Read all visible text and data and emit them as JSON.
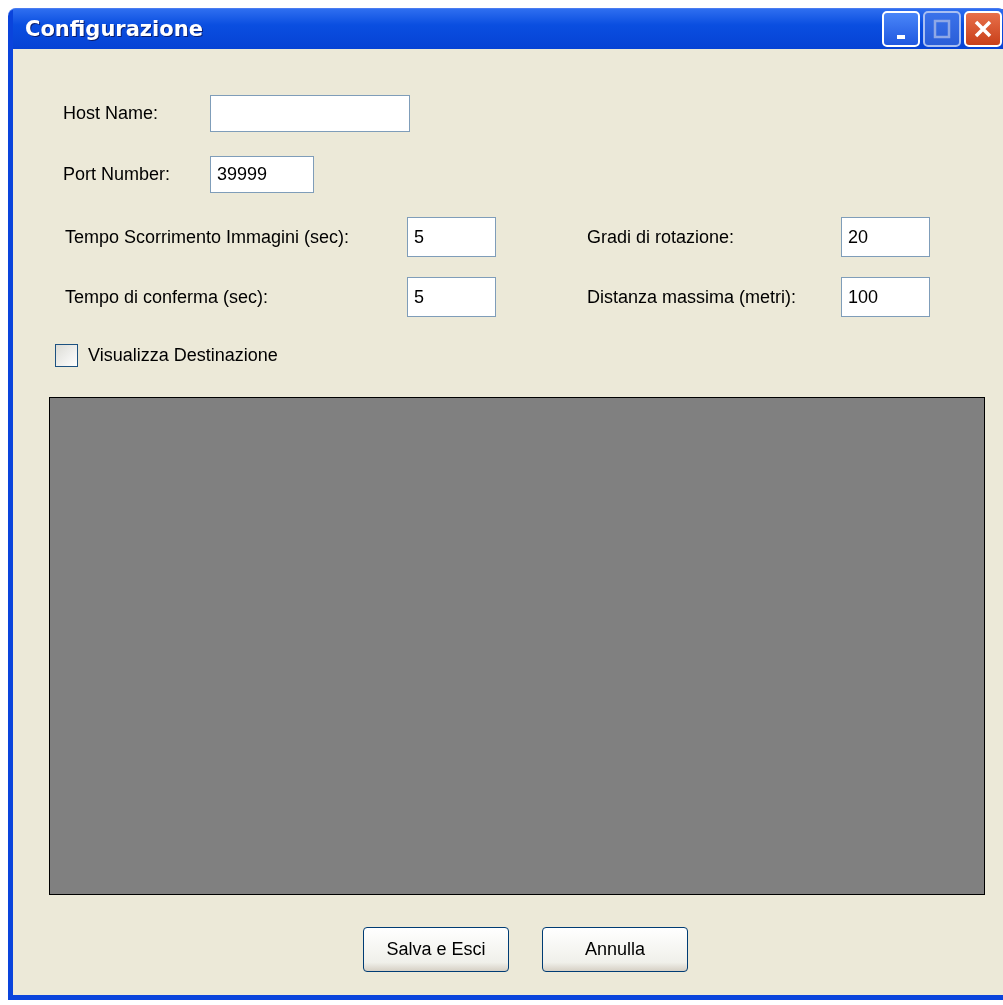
{
  "window": {
    "title": "Configurazione"
  },
  "fields": [
    {
      "label": "Host Name:"
    },
    {
      "label": "Port Number:",
      "value": "39999"
    }
  ],
  "left_fields": [
    {
      "label": "Tempo Scorrimento Immagini (sec):",
      "value": "5"
    },
    {
      "label": "Tempo di conferma (sec):",
      "value": "5"
    }
  ],
  "right_fields": [
    {
      "label": "Gradi di rotazione:",
      "value": "20"
    },
    {
      "label": "Distanza massima (metri):",
      "value": "100"
    }
  ],
  "checkbox": {
    "label": "Visualizza Destinazione",
    "checked": false
  },
  "buttons": [
    "Salva e Esci",
    "Annulla"
  ]
}
